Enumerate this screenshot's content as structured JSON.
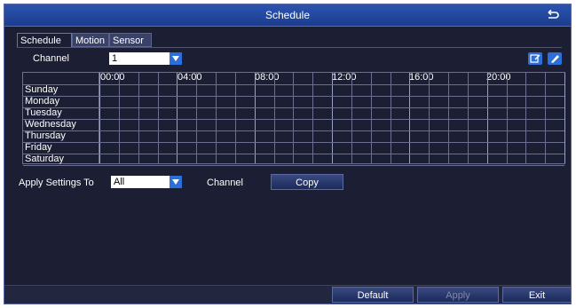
{
  "window": {
    "title": "Schedule"
  },
  "tabs": [
    {
      "label": "Schedule",
      "active": true
    },
    {
      "label": "Motion",
      "active": false
    },
    {
      "label": "Sensor",
      "active": false
    }
  ],
  "channel": {
    "label": "Channel",
    "value": "1"
  },
  "grid": {
    "hour_labels": [
      "00:00",
      "04:00",
      "08:00",
      "12:00",
      "16:00",
      "20:00"
    ],
    "days": [
      "Sunday",
      "Monday",
      "Tuesday",
      "Wednesday",
      "Thursday",
      "Friday",
      "Saturday"
    ]
  },
  "apply": {
    "label": "Apply Settings To",
    "value": "All",
    "channel_label": "Channel",
    "copy_label": "Copy"
  },
  "footer": {
    "default_label": "Default",
    "apply_label": "Apply",
    "exit_label": "Exit"
  },
  "colors": {
    "background": "#1c1f33",
    "titlebar": "#2c55b0",
    "accent": "#2d6fd8"
  }
}
